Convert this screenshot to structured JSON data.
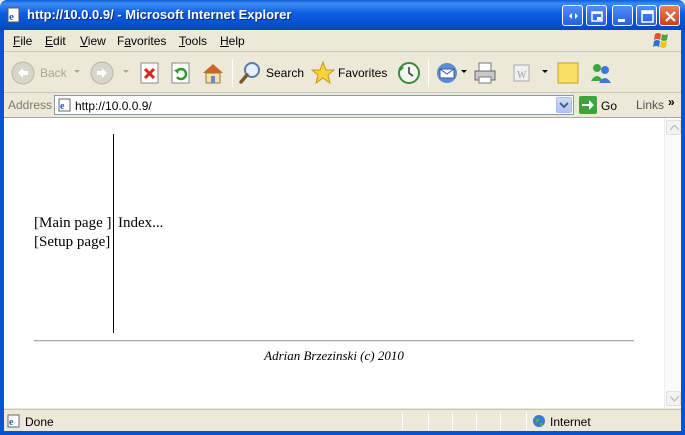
{
  "window": {
    "title": "http://10.0.0.9/ - Microsoft Internet Explorer"
  },
  "menubar": {
    "items": [
      {
        "label": "File",
        "accel": "F"
      },
      {
        "label": "Edit",
        "accel": "E"
      },
      {
        "label": "View",
        "accel": "V"
      },
      {
        "label": "Favorites",
        "accel": "a"
      },
      {
        "label": "Tools",
        "accel": "T"
      },
      {
        "label": "Help",
        "accel": "H"
      }
    ]
  },
  "toolbar": {
    "back_label": "Back",
    "search_label": "Search",
    "favorites_label": "Favorites"
  },
  "address": {
    "label": "Address",
    "url": "http://10.0.0.9/",
    "go_label": "Go",
    "links_label": "Links"
  },
  "page": {
    "nav": [
      {
        "label": "[Main page ]"
      },
      {
        "label": "[Setup page]"
      }
    ],
    "content": "Index...",
    "footer": "Adrian Brzezinski (c) 2010"
  },
  "status": {
    "text": "Done",
    "zone": "Internet"
  }
}
